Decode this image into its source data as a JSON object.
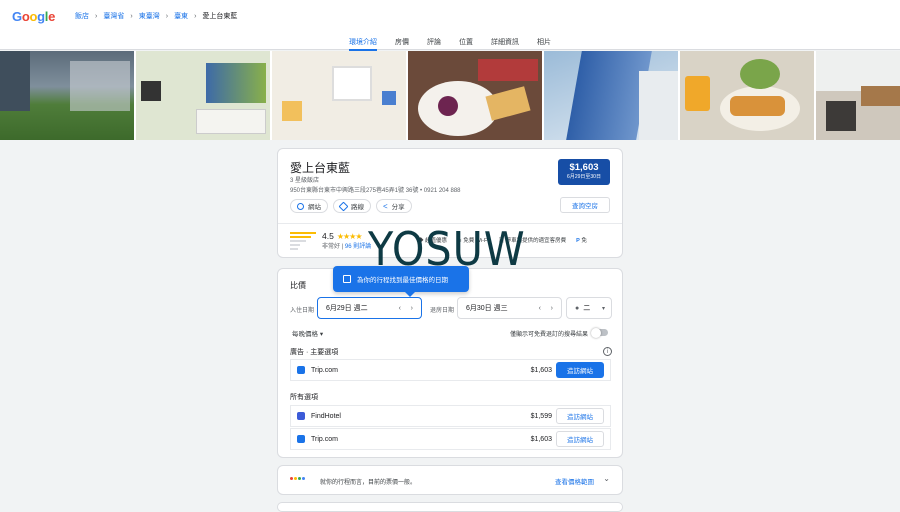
{
  "header": {
    "logo_letters": [
      "G",
      "o",
      "o",
      "g",
      "l",
      "e"
    ],
    "breadcrumbs": [
      "飯店",
      "臺灣省",
      "東臺灣",
      "臺東",
      "愛上台東藍"
    ]
  },
  "tabs": [
    "環境介紹",
    "房價",
    "評論",
    "位置",
    "詳細資訊",
    "相片"
  ],
  "hotel": {
    "name": "愛上台東藍",
    "class": "3 星級飯店",
    "address": "950台東縣台東市中興路三段275巷45弄1號 36號 • 0921 204 888",
    "price": "$1,603",
    "price_dates": "6月29日至30日",
    "check_rooms": "查詢空房",
    "actions": [
      "網站",
      "路線",
      "分享"
    ],
    "rating": "4.5",
    "rating_text": "非常好",
    "review_count": "96 則評論",
    "amenities": [
      {
        "label": "超值優惠",
        "icon": "tag-icon"
      },
      {
        "label": "免費 Wi-Fi",
        "icon": "wifi-icon"
      },
      {
        "label": "停車場提供的適宜客房費",
        "icon": "car-icon"
      },
      {
        "label": "免",
        "icon": "parking-icon"
      }
    ]
  },
  "pricing": {
    "title": "比價",
    "tooltip": "為你的行程找到最佳價格的日期",
    "checkin_label": "入住日期",
    "checkin_value": "6月29日 週二",
    "checkout_label": "退房日期",
    "checkout_value": "6月30日 週三",
    "guests_value": "二",
    "per_night": "每晚價格",
    "free_cancel": "僅顯示可免費退訂的搜尋結果",
    "sponsored_title": "廣告 · 主要選項",
    "all_title": "所有選項",
    "sponsored": [
      {
        "site": "Trip.com",
        "price": "$1,603",
        "button": "造訪網站",
        "color": "#1a73e8"
      }
    ],
    "options": [
      {
        "site": "FindHotel",
        "price": "$1,599",
        "button": "造訪網站",
        "color": "#3c5bd8"
      },
      {
        "site": "Trip.com",
        "price": "$1,603",
        "button": "造訪網站",
        "color": "#1a73e8"
      }
    ]
  },
  "bottom": {
    "text": "就你的行程而言，目前的票價一般。",
    "link": "查看價格範圍"
  },
  "watermark": "YOSUW",
  "colors": {
    "accent": "#1a73e8",
    "price_box": "#174ea6",
    "star": "#fbbc04"
  }
}
